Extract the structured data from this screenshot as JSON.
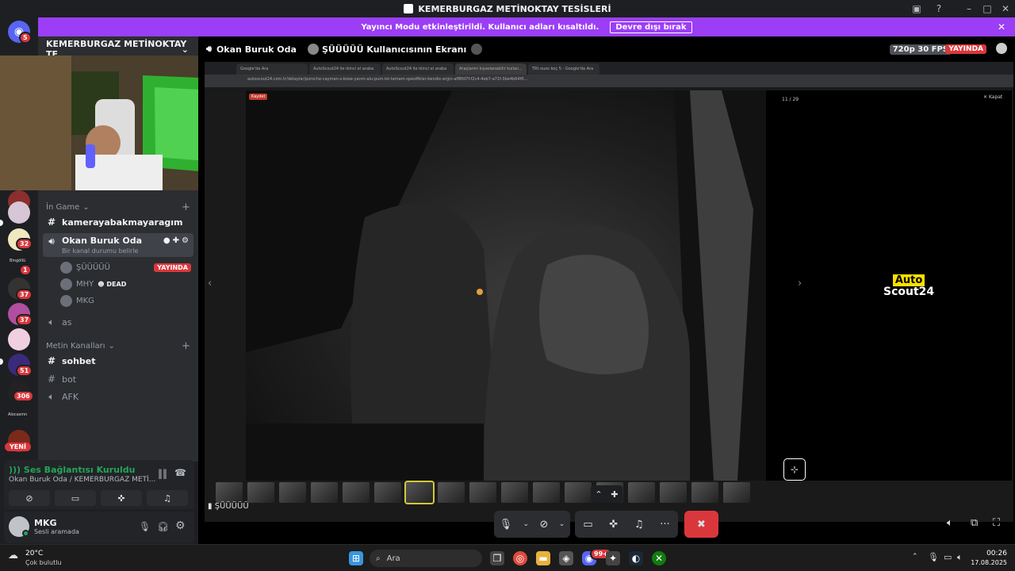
{
  "window": {
    "title": "KEMERBURGAZ METİNOKTAY TESİSLERİ"
  },
  "banner": {
    "message": "Yayıncı Modu etkinleştirildi. Kullanıcı adları kısaltıldı.",
    "button": "Devre dışı bırak"
  },
  "server": {
    "name": "KEMERBURGAZ METİNOKTAY TE..."
  },
  "rail": {
    "badges": [
      "5",
      "32",
      "1",
      "37",
      "37",
      "51",
      "306"
    ],
    "new_label": "YENİ",
    "labels": [
      "Bingöllü",
      "Alocasmn"
    ]
  },
  "channels": {
    "cat_game": "İn Game",
    "cat_text": "Metin Kanalları",
    "items": {
      "kamera": "kamerayabakmayaragım",
      "okan": "Okan Buruk Oda",
      "okan_status": "Bir kanal durumu belirle",
      "as": "as",
      "sohbet": "sohbet",
      "bot": "bot",
      "afk": "AFK"
    },
    "voice_users": [
      {
        "name": "ŞÜÜÜÜÜ",
        "tag": "YAYINDA"
      },
      {
        "name": "MHY",
        "tag": "DEAD"
      },
      {
        "name": "MKG",
        "tag": ""
      }
    ]
  },
  "voice_panel": {
    "status": "Ses Bağlantısı Kuruldu",
    "location": "Okan Buruk Oda / KEMERBURGAZ METİ..."
  },
  "user_panel": {
    "name": "MKG",
    "status": "Sesli aramada"
  },
  "stage": {
    "room": "Okan Buruk Oda",
    "screen_title": "ŞÜÜÜÜÜ Kullanıcısının Ekranı",
    "quality": "720p 30 FPS",
    "live": "YAYINDA",
    "stream_user": "ŞÜÜÜÜÜ"
  },
  "browser": {
    "tabs": [
      "Google'da Ara",
      "AutoScout24 ile ikinci el araba",
      "AutoScout24 ile ikinci el araba",
      "Araçlarım kıyaslanabilir kullan...",
      "TRt ouzo koç 5 - Google'da Ara"
    ],
    "url": "autoscout24.com.tr/detaylar/porsche-cayman-s-boxe-yanm-alu-pum-ist-tamam-spesifikler-bendix-ergin-aff8fd7f-f2c4-4eb7-a71f-3be4b64f0..."
  },
  "gallery": {
    "counter": "11 / 29",
    "close": "Kapat",
    "saved": "Kaydet"
  },
  "brand": {
    "line1": "Auto",
    "line2": "Scout24"
  },
  "taskbar": {
    "weather_temp": "20°C",
    "weather_desc": "Çok bulutlu",
    "search": "Ara",
    "time": "00:26",
    "date": "17.08.2025",
    "badge": "99+"
  },
  "colors": {
    "accent": "#5865f2",
    "banner": "#9b3ef6",
    "live": "#da373c",
    "green": "#23a55a",
    "brand_yellow": "#ffe000"
  }
}
